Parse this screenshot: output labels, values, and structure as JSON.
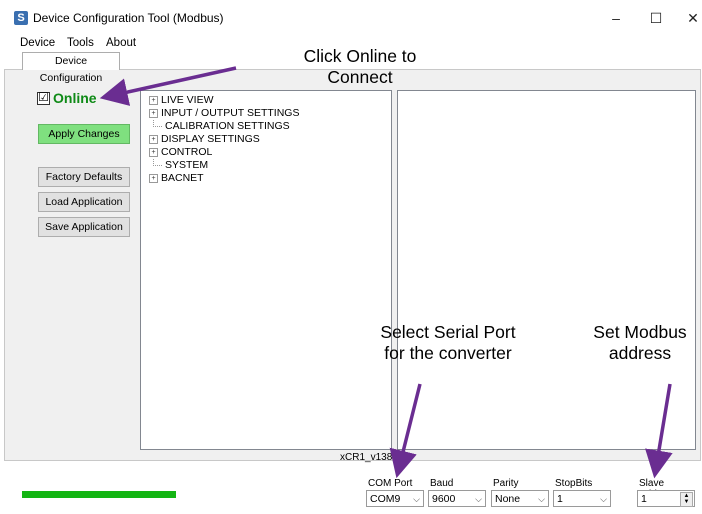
{
  "window": {
    "title": "Device Configuration Tool (Modbus)",
    "icon_letter": "S",
    "controls": {
      "minimize": "–",
      "maximize": "☐",
      "close": "✕"
    }
  },
  "menu": [
    "Device",
    "Tools",
    "About"
  ],
  "tab": {
    "label": "Device Configuration"
  },
  "left_panel": {
    "online_checked": true,
    "online_check_glyph": "☑",
    "online_label": "Online",
    "apply_label": "Apply Changes",
    "factory_label": "Factory Defaults",
    "load_label": "Load Application",
    "save_label": "Save Application",
    "apply_color": "#7fe07f"
  },
  "tree": {
    "items": [
      {
        "label": "LIVE VIEW",
        "expandable": true
      },
      {
        "label": "INPUT / OUTPUT SETTINGS",
        "expandable": true
      },
      {
        "label": "CALIBRATION SETTINGS",
        "expandable": false
      },
      {
        "label": "DISPLAY SETTINGS",
        "expandable": true
      },
      {
        "label": "CONTROL",
        "expandable": true
      },
      {
        "label": "SYSTEM",
        "expandable": false
      },
      {
        "label": "BACNET",
        "expandable": true
      }
    ],
    "expander_glyph": "+"
  },
  "version": "xCR1_v138",
  "status": {
    "progress": 1.0,
    "progress_color": "#13b513"
  },
  "connection": {
    "com_port": {
      "label": "COM Port",
      "value": "COM9"
    },
    "baud": {
      "label": "Baud",
      "value": "9600"
    },
    "parity": {
      "label": "Parity",
      "value": "None"
    },
    "stop_bits": {
      "label": "StopBits",
      "value": "1"
    },
    "slave_address": {
      "label": "Slave Address",
      "value": "1"
    },
    "chevron": "⌵"
  },
  "annotations": {
    "click_online_1": "Click Online to",
    "click_online_2": "Connect",
    "serial_port_1": "Select Serial Port",
    "serial_port_2": "for the converter",
    "modbus_1": "Set Modbus",
    "modbus_2": "address",
    "arrow_color": "#6a2d91"
  }
}
